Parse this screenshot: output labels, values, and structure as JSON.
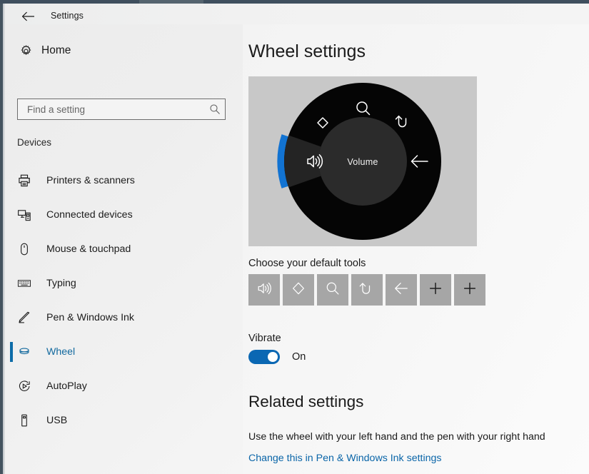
{
  "window": {
    "title": "Settings",
    "back_icon": "back-arrow-icon"
  },
  "sidebar": {
    "home": {
      "label": "Home",
      "icon": "gear-icon"
    },
    "search": {
      "value": "",
      "placeholder": "Find a setting",
      "icon": "search-icon"
    },
    "group_label": "Devices",
    "items": [
      {
        "label": "Printers & scanners",
        "icon": "printer-icon",
        "selected": false
      },
      {
        "label": "Connected devices",
        "icon": "connected-devices-icon",
        "selected": false
      },
      {
        "label": "Mouse & touchpad",
        "icon": "mouse-icon",
        "selected": false
      },
      {
        "label": "Typing",
        "icon": "keyboard-icon",
        "selected": false
      },
      {
        "label": "Pen & Windows Ink",
        "icon": "pen-icon",
        "selected": false
      },
      {
        "label": "Wheel",
        "icon": "wheel-icon",
        "selected": true
      },
      {
        "label": "AutoPlay",
        "icon": "autoplay-icon",
        "selected": false
      },
      {
        "label": "USB",
        "icon": "usb-icon",
        "selected": false
      }
    ]
  },
  "main": {
    "page_title": "Wheel settings",
    "preview": {
      "center_label": "Volume",
      "segments": [
        {
          "icon": "scroll-updown-icon",
          "highlighted": false
        },
        {
          "icon": "search-icon",
          "highlighted": false
        },
        {
          "icon": "undo-icon",
          "highlighted": false
        },
        {
          "icon": "back-arrow-icon",
          "highlighted": false
        },
        {
          "icon": "empty-segment",
          "highlighted": false
        },
        {
          "icon": "volume-icon",
          "highlighted": true
        }
      ]
    },
    "tools_heading": "Choose your default tools",
    "tools": [
      {
        "icon": "volume-icon",
        "kind": "tool"
      },
      {
        "icon": "scroll-updown-icon",
        "kind": "tool"
      },
      {
        "icon": "search-icon",
        "kind": "tool"
      },
      {
        "icon": "undo-icon",
        "kind": "tool"
      },
      {
        "icon": "back-arrow-icon",
        "kind": "tool"
      },
      {
        "icon": "plus-icon",
        "kind": "add"
      },
      {
        "icon": "plus-icon",
        "kind": "add"
      }
    ],
    "vibrate": {
      "label": "Vibrate",
      "state": "On",
      "enabled": true
    },
    "related": {
      "title": "Related settings",
      "text": "Use the wheel with your left hand and the pen with your right hand",
      "link": "Change this in Pen & Windows Ink settings"
    }
  },
  "colors": {
    "accent": "#0d6ca8",
    "link": "#0a65a8",
    "toggle_on": "#0a67b3",
    "preview_bg": "#c8c8c8",
    "wheel_black": "#050505",
    "tool_tile": "#a6a6a6"
  }
}
